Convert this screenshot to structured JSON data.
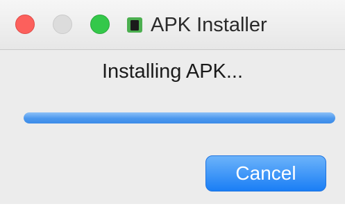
{
  "window": {
    "title": "APK Installer",
    "app_icon": "android-app-icon",
    "traffic_lights": {
      "close_color": "#fc605c",
      "minimize_color": "#dcdcdc",
      "zoom_color": "#34c84a"
    }
  },
  "dialog": {
    "status_text": "Installing APK...",
    "progress": {
      "value": 1.0,
      "color": "#4b98ee"
    },
    "cancel_label": "Cancel"
  },
  "colors": {
    "accent": "#1a7ef5",
    "app_icon_green": "#4caf50"
  }
}
